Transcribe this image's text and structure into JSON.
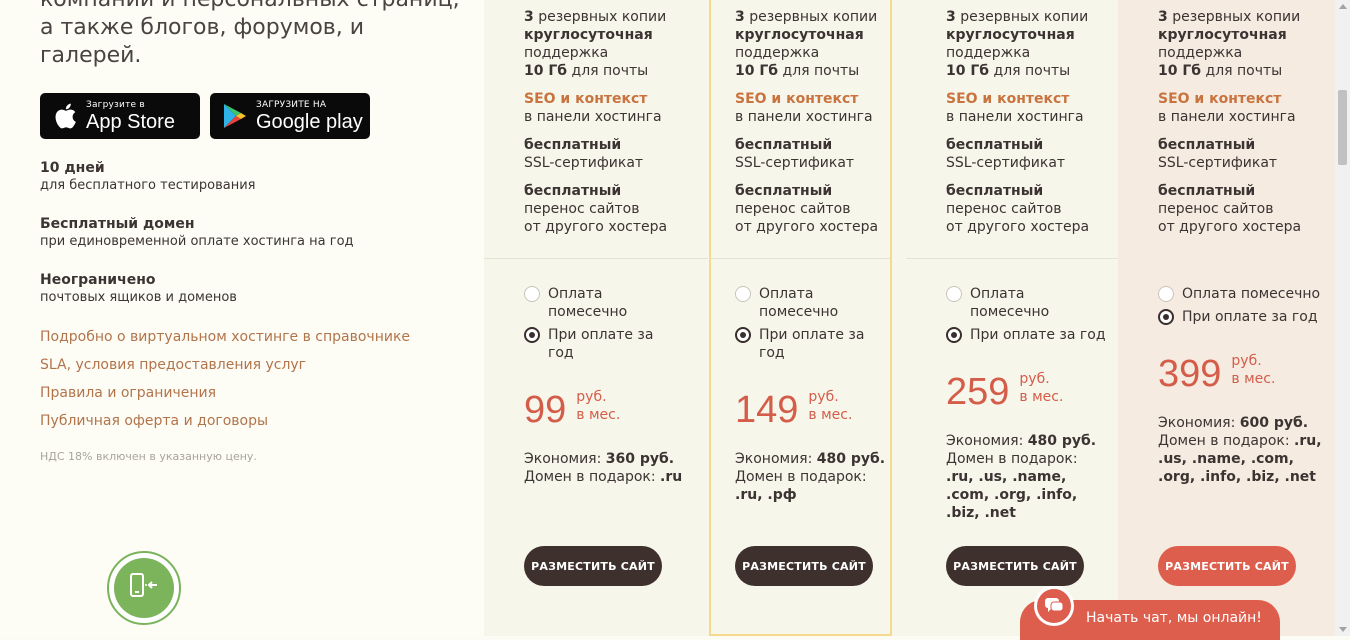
{
  "left": {
    "tagline": "компаний и персональных страниц, а также блогов, форумов, и галерей.",
    "app_store": {
      "small": "Загрузите в",
      "big": "App Store"
    },
    "google_play": {
      "small": "ЗАГРУЗИТЕ НА",
      "big": "Google play"
    },
    "features": [
      {
        "title": "10 дней",
        "sub": "для бесплатного тестирования"
      },
      {
        "title": "Бесплатный домен",
        "sub": "при единовременной оплате хостинга на год"
      },
      {
        "title": "Неограничено",
        "sub": "почтовых ящиков и доменов"
      }
    ],
    "links": [
      "Подробно о виртуальном хостинге в справочнике",
      "SLA, условия предоставления услуг",
      "Правила и ограничения",
      "Публичная оферта и договоры"
    ],
    "vat": "НДС 18% включен в указанную цену."
  },
  "plan_common": {
    "backups_num": "3",
    "backups_text": " резервных копии",
    "support_bold": "круглосуточная",
    "support_text": "поддержка",
    "mail_bold": "10 Гб",
    "mail_text": " для почты",
    "seo_bold": "SEO и контекст",
    "seo_text": "в панели хостинга",
    "ssl_bold": "бесплатный",
    "ssl_text": "SSL-сертификат",
    "transfer_bold": "бесплатный",
    "transfer_text1": "перенос сайтов",
    "transfer_text2": "от другого хостера",
    "radio_monthly": "Оплата помесечно",
    "radio_monthly_l1": "Оплата",
    "radio_monthly_l2": "помесечно",
    "radio_yearly": "При оплате за год",
    "radio_yearly_l1": "При оплате за",
    "radio_yearly_l2": "год",
    "currency": "руб.",
    "per": "в мес.",
    "savings_label": "Экономия:",
    "gift_label": "Домен в подарок:",
    "button": "РАЗМЕСТИТЬ САЙТ"
  },
  "plans": [
    {
      "price": "99",
      "savings": "360 руб.",
      "domains": [
        ".ru"
      ]
    },
    {
      "price": "149",
      "savings": "480 руб.",
      "domains": [
        ".ru, .рф"
      ]
    },
    {
      "price": "259",
      "savings": "480 руб.",
      "domains": [
        ".ru, .us, .name,",
        ".com, .org, .info,",
        ".biz, .net"
      ]
    },
    {
      "price": "399",
      "savings": "600 руб.",
      "domains": [
        ".ru,",
        ".us, .name, .com,",
        ".org, .info, .biz, .net"
      ]
    }
  ],
  "chat": {
    "label": "Начать чат, мы онлайн!"
  },
  "colors": {
    "accent": "#dd5e4d",
    "dark_button": "#3e302d",
    "link": "#b2744b",
    "seo": "#c9733e",
    "highlight_border": "#f5d98c"
  }
}
